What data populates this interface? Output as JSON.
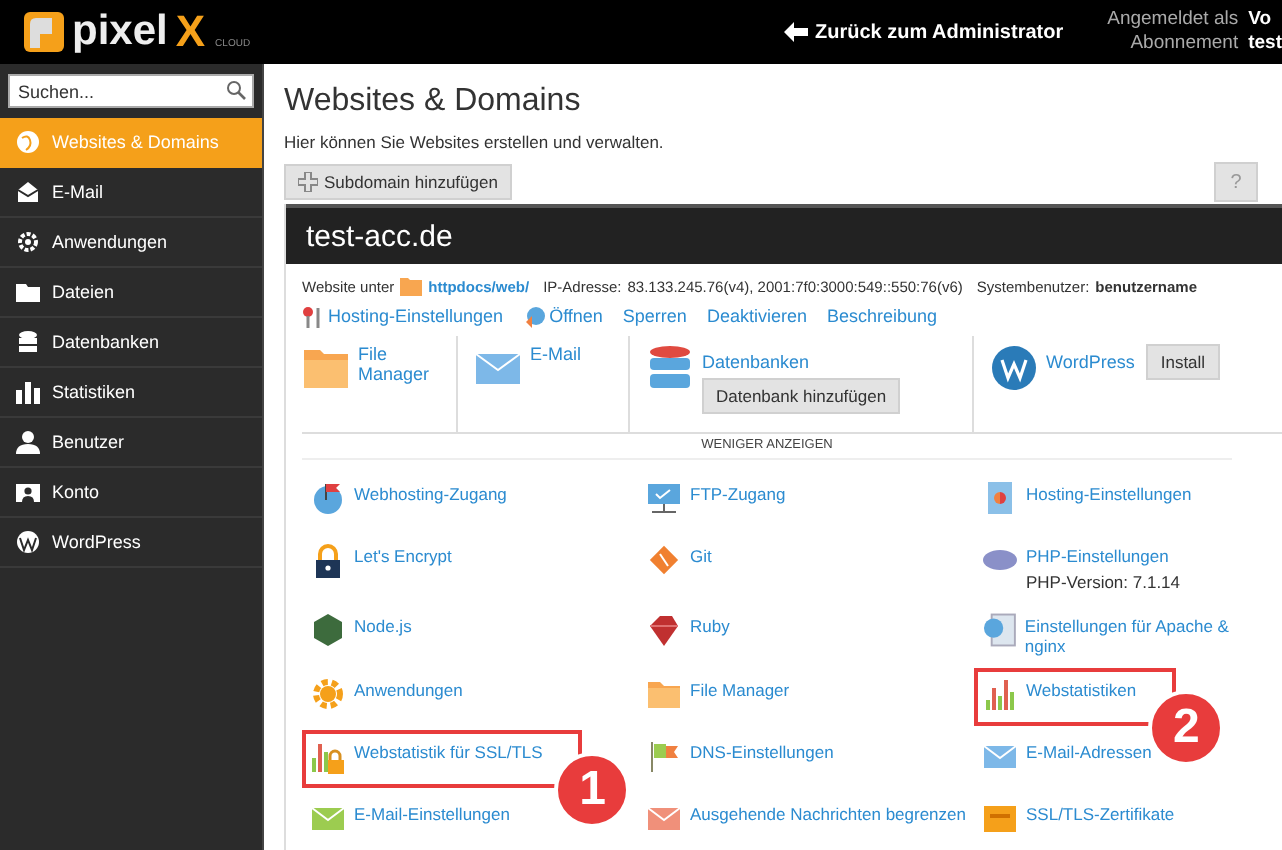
{
  "header": {
    "logo": {
      "word": "pixel",
      "letter": "X",
      "sub": "CLOUD"
    },
    "back_link": "Zurück zum Administrator",
    "account": [
      {
        "label": "Angemeldet als",
        "value": "Vo"
      },
      {
        "label": "Abonnement",
        "value": "test"
      }
    ]
  },
  "sidebar": {
    "search": {
      "placeholder": "Suchen..."
    },
    "items": [
      {
        "label": "Websites & Domains",
        "selected": true
      },
      {
        "label": "E-Mail",
        "selected": false
      },
      {
        "label": "Anwendungen",
        "selected": false
      },
      {
        "label": "Dateien",
        "selected": false
      },
      {
        "label": "Datenbanken",
        "selected": false
      },
      {
        "label": "Statistiken",
        "selected": false
      },
      {
        "label": "Benutzer",
        "selected": false
      },
      {
        "label": "Konto",
        "selected": false
      },
      {
        "label": "WordPress",
        "selected": false
      }
    ]
  },
  "main": {
    "title": "Websites & Domains",
    "subtitle": "Hier können Sie Websites erstellen und verwalten.",
    "add_button": "Subdomain hinzufügen",
    "help_button": "?",
    "domain": {
      "name": "test-acc.de",
      "info": [
        {
          "label": "Website unter",
          "value": "httpdocs/web/",
          "kind": "link"
        },
        {
          "label": "IP-Adresse:",
          "value": "83.133.245.76(v4), 2001:7f0:3000:549::550:76(v6)",
          "kind": "text"
        },
        {
          "label": "Systembenutzer:",
          "value": "benutzername",
          "kind": "bold"
        }
      ],
      "actions": [
        "Hosting-Einstellungen",
        "Öffnen",
        "Sperren",
        "Deaktivieren",
        "Beschreibung"
      ],
      "tiles": [
        {
          "label": "File Manager"
        },
        {
          "label": "E-Mail"
        },
        {
          "label": "Datenbanken",
          "button": "Datenbank hinzufügen"
        },
        {
          "label": "WordPress",
          "button": "Install"
        }
      ],
      "toggle": "WENIGER ANZEIGEN",
      "tools": [
        {
          "label": "Webhosting-Zugang"
        },
        {
          "label": "FTP-Zugang"
        },
        {
          "label": "Hosting-Einstellungen"
        },
        {
          "label": "Let's Encrypt"
        },
        {
          "label": "Git"
        },
        {
          "label": "PHP-Einstellungen",
          "note": "PHP-Version: 7.1.14"
        },
        {
          "label": "Node.js"
        },
        {
          "label": "Ruby"
        },
        {
          "label": "Einstellungen für Apache & nginx"
        },
        {
          "label": "Anwendungen"
        },
        {
          "label": "File Manager"
        },
        {
          "label": "Webstatistiken",
          "marker": "2"
        },
        {
          "label": "Webstatistik für SSL/TLS",
          "marker": "1"
        },
        {
          "label": "DNS-Einstellungen"
        },
        {
          "label": "E-Mail-Adressen"
        },
        {
          "label": "E-Mail-Einstellungen"
        },
        {
          "label": "Ausgehende Nachrichten begrenzen"
        },
        {
          "label": "SSL/TLS-Zertifikate"
        }
      ]
    }
  }
}
